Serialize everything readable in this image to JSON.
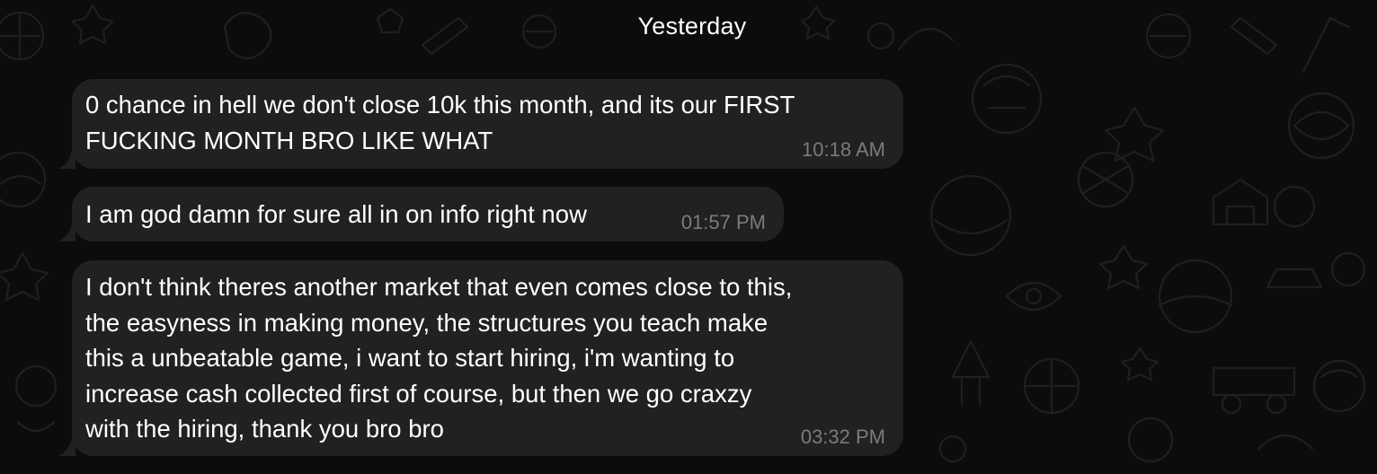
{
  "chat": {
    "date_separator": "Yesterday",
    "messages": [
      {
        "text": "0 chance in hell we don't close 10k this month, and its our FIRST\nFUCKING MONTH BRO LIKE WHAT",
        "time": "10:18 AM"
      },
      {
        "text": "I am god damn for sure all in on info right now",
        "time": "01:57 PM"
      },
      {
        "text": "I don't think theres another market that even comes close to this,\nthe easyness in making money, the structures you teach make\nthis a unbeatable game, i want to start hiring, i'm wanting to\nincrease cash collected first of course, but then we go craxzy\nwith the hiring, thank you bro bro",
        "time": "03:32 PM"
      }
    ]
  },
  "theme": {
    "background": "#0c0c0c",
    "bubble": "#212121",
    "text": "#ffffff",
    "time": "#7b7b7b"
  }
}
